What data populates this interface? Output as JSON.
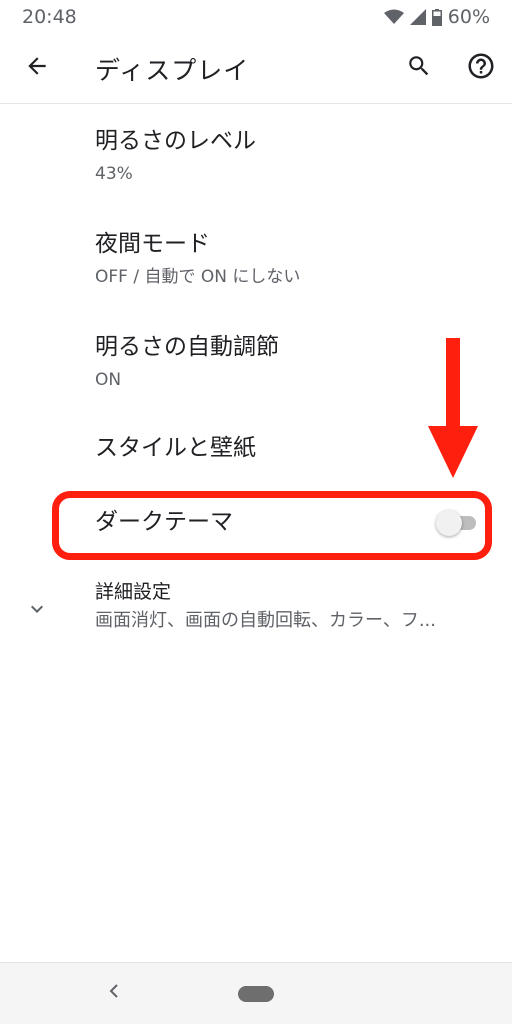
{
  "status_bar": {
    "time": "20:48",
    "battery_text": "60%",
    "icons": [
      "wifi-icon",
      "signal-icon",
      "battery-icon"
    ]
  },
  "app_bar": {
    "title": "ディスプレイ",
    "icons": [
      "back-arrow-icon",
      "search-icon",
      "help-icon"
    ]
  },
  "settings": [
    {
      "title": "明るさのレベル",
      "summary": "43%"
    },
    {
      "title": "夜間モード",
      "summary": "OFF / 自動で ON にしない"
    },
    {
      "title": "明るさの自動調節",
      "summary": "ON"
    },
    {
      "title": "スタイルと壁紙",
      "summary": ""
    }
  ],
  "dark_theme": {
    "title": "ダークテーマ",
    "enabled": false
  },
  "advanced": {
    "title": "詳細設定",
    "summary": "画面消灯、画面の自動回転、カラー、フ..."
  },
  "colors": {
    "annotation_red": "#ff1f0f",
    "text_primary": "#202124",
    "text_secondary": "#5f6368"
  }
}
